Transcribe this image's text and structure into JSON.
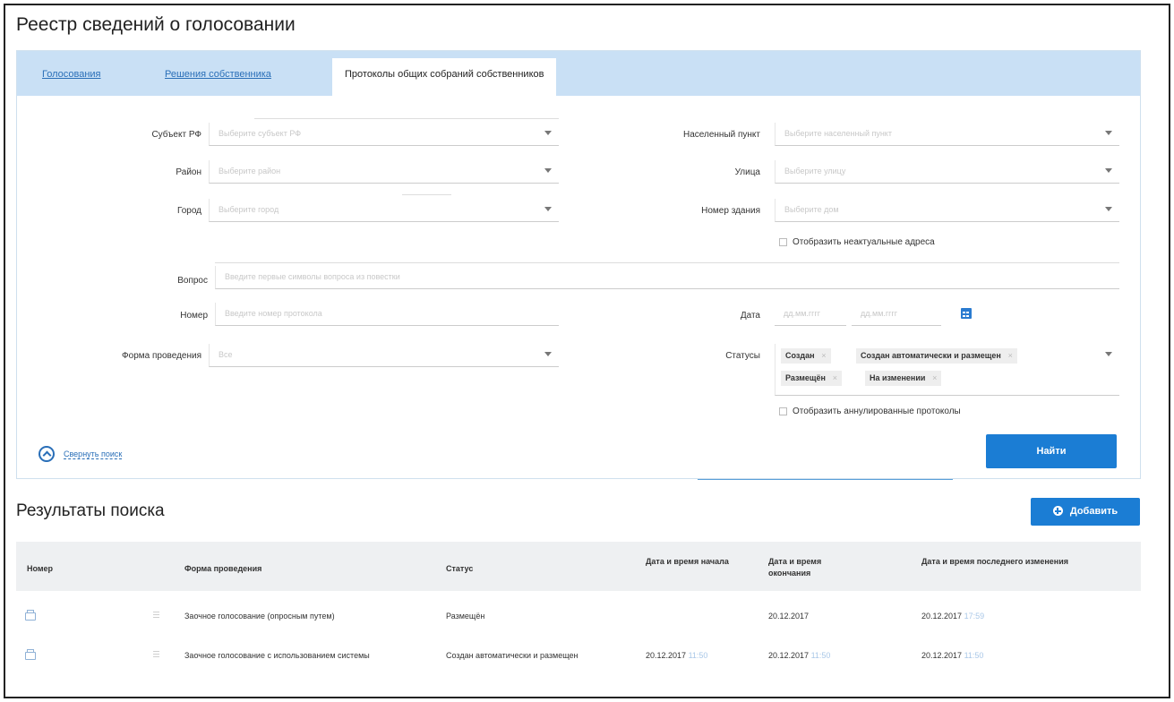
{
  "page": {
    "title": "Реестр сведений о голосовании"
  },
  "tabs": [
    {
      "label": "Голосования",
      "active": false
    },
    {
      "label": "Решения собственника",
      "active": false
    },
    {
      "label": "Протоколы общих собраний собственников",
      "active": true
    }
  ],
  "filters": {
    "subject": {
      "label": "Субъект РФ",
      "placeholder": "Выберите субъект РФ"
    },
    "locality": {
      "label": "Населенный пункт",
      "placeholder": "Выберите населенный пункт"
    },
    "district": {
      "label": "Район",
      "placeholder": "Выберите район"
    },
    "street": {
      "label": "Улица",
      "placeholder": "Выберите улицу"
    },
    "city": {
      "label": "Город",
      "placeholder": "Выберите город"
    },
    "building": {
      "label": "Номер здания",
      "placeholder": "Выберите дом"
    },
    "show_inactive_addresses": {
      "label": "Отобразить неактуальные адреса",
      "checked": false
    },
    "question": {
      "label": "Вопрос",
      "placeholder": "Введите первые символы вопроса из повестки"
    },
    "number": {
      "label": "Номер",
      "placeholder": "Введите номер протокола"
    },
    "date": {
      "label": "Дата",
      "from_placeholder": "дд.мм.гггг",
      "to_placeholder": "дд.мм.гггг"
    },
    "form": {
      "label": "Форма проведения",
      "value": "Все"
    },
    "statuses": {
      "label": "Статусы",
      "tags": [
        "Создан",
        "Создан автоматически и размещен",
        "Размещён",
        "На изменении"
      ]
    },
    "show_annulled": {
      "label": "Отобразить аннулированные протоколы",
      "checked": false
    }
  },
  "actions": {
    "collapse_label": "Свернуть поиск",
    "search_button": "Найти",
    "add_button": "Добавить"
  },
  "results": {
    "title": "Результаты поиска",
    "columns": [
      "Номер",
      "Форма проведения",
      "Статус",
      "Дата и время начала",
      "Дата и время окончания",
      "Дата и время последнего изменения"
    ],
    "rows": [
      {
        "form": "Заочное голосование (опросным путем)",
        "status": "Размещён",
        "start_date": "",
        "start_time": "",
        "end_date": "20.12.2017",
        "end_time": "",
        "modified_date": "20.12.2017",
        "modified_time": "17:59"
      },
      {
        "form": "Заочное голосование с использованием системы",
        "status": "Создан автоматически и размещен",
        "start_date": "20.12.2017",
        "start_time": "11:50",
        "end_date": "20.12.2017",
        "end_time": "11:50",
        "modified_date": "20.12.2017",
        "modified_time": "11:50"
      }
    ]
  },
  "colors": {
    "accent": "#1b7dd4",
    "tabbar": "#c9e0f5",
    "link": "#2a6fb8"
  }
}
